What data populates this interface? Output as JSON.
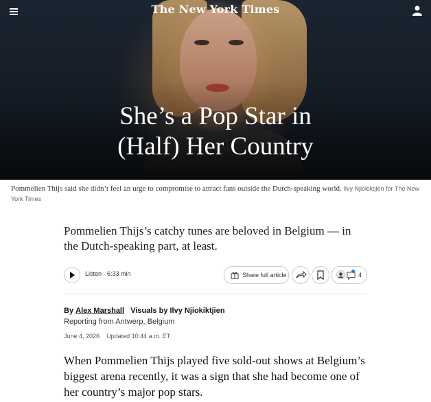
{
  "header": {
    "logo": "The New York Times",
    "menu_icon": "hamburger-menu-icon",
    "account_icon": "user-account-icon"
  },
  "hero": {
    "headline_line1": "She’s a Pop Star in",
    "headline_line2": "(Half) Her Country"
  },
  "caption": {
    "text": "Pommelien Thijs said she didn’t feel an urge to compromise to attract fans outside the Dutch-speaking world.",
    "credit": "Ilvy Njiokiktjien for The New York Times"
  },
  "summary": "Pommelien Thijs’s catchy tunes are beloved in Belgium — in the Dutch-speaking part, at least.",
  "toolbar": {
    "listen_label": "Listen · 6:33 min",
    "share_label": "Share full article",
    "comments_count": "4",
    "play_icon": "play-icon",
    "gift_icon": "gift-icon",
    "share_icon": "share-arrow-icon",
    "bookmark_icon": "bookmark-icon",
    "comment_icon": "comment-icon"
  },
  "byline": {
    "prefix": "By",
    "author": "Alex Marshall",
    "visuals": "Visuals by Ilvy Njiokiktjien",
    "reporting": "Reporting from Antwerp, Belgium",
    "date": "June 4, 2026",
    "updated": "Updated 10:44 a.m. ET"
  },
  "body": "When Pommelien Thijs played five sold-out shows at Belgium’s biggest arena recently, it was a sign that she had become one of her country’s major pop stars.",
  "colors": {
    "notification_dot": "#1a73e8",
    "text": "#121212"
  }
}
